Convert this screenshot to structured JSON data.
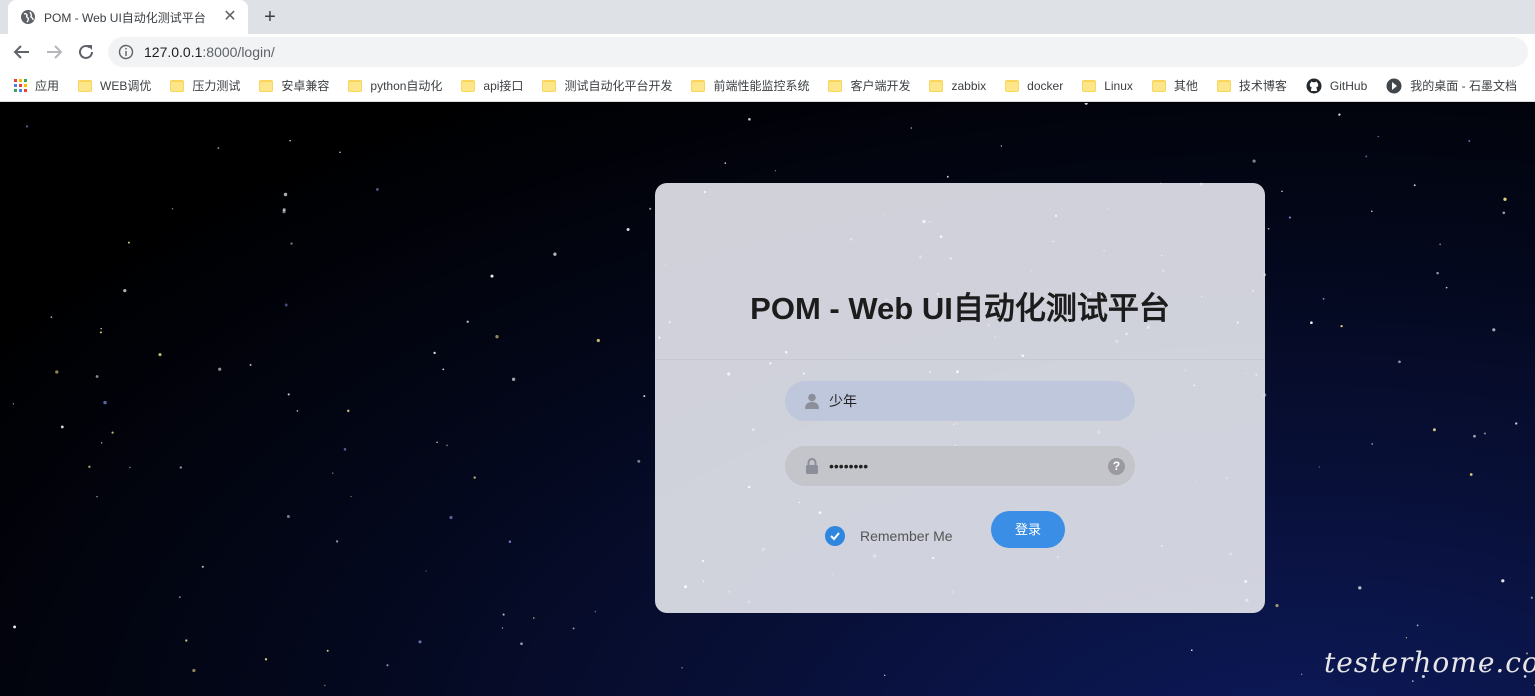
{
  "browser": {
    "tab": {
      "title": "POM - Web UI自动化测试平台",
      "close_glyph": "✕"
    },
    "new_tab_glyph": "+",
    "address": {
      "host": "127.0.0.1",
      "path": ":8000/login/"
    },
    "bookmarks": [
      {
        "label": "应用",
        "icon": "apps-icon"
      },
      {
        "label": "WEB调优",
        "icon": "folder-icon"
      },
      {
        "label": "压力测试",
        "icon": "folder-icon"
      },
      {
        "label": "安卓兼容",
        "icon": "folder-icon"
      },
      {
        "label": "python自动化",
        "icon": "folder-icon"
      },
      {
        "label": "api接口",
        "icon": "folder-icon"
      },
      {
        "label": "测试自动化平台开发",
        "icon": "folder-icon"
      },
      {
        "label": "前端性能监控系统",
        "icon": "folder-icon"
      },
      {
        "label": "客户端开发",
        "icon": "folder-icon"
      },
      {
        "label": "zabbix",
        "icon": "folder-icon"
      },
      {
        "label": "docker",
        "icon": "folder-icon"
      },
      {
        "label": "Linux",
        "icon": "folder-icon"
      },
      {
        "label": "其他",
        "icon": "folder-icon"
      },
      {
        "label": "技术博客",
        "icon": "folder-icon"
      },
      {
        "label": "GitHub",
        "icon": "github-icon"
      },
      {
        "label": "我的桌面 - 石墨文档",
        "icon": "shimo-icon"
      }
    ]
  },
  "login": {
    "title": "POM - Web UI自动化测试平台",
    "username": {
      "value": "少年",
      "icon": "user-icon"
    },
    "password": {
      "value": "••••••••",
      "icon": "lock-icon",
      "help_glyph": "?"
    },
    "remember_label": "Remember Me",
    "remember_checked": true,
    "submit_label": "登录"
  },
  "watermark": "testerhome.com",
  "colors": {
    "accent": "#3a8ee6",
    "checkbox": "#2e86de",
    "card_bg": "#e7e8f0",
    "folder": "#f9d65b"
  }
}
